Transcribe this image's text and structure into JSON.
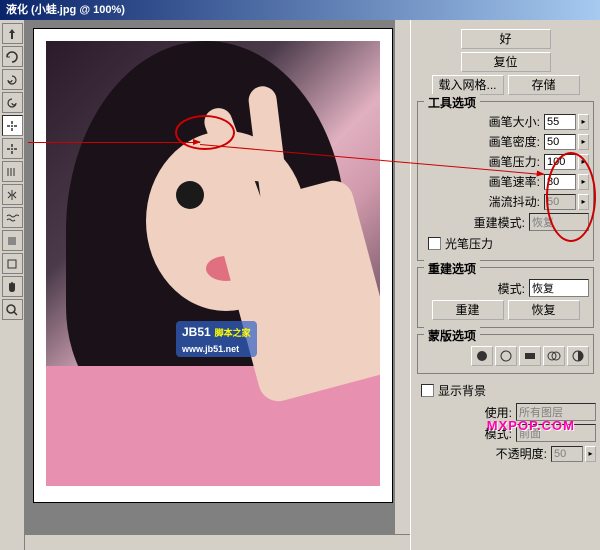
{
  "title": "液化 (小蛙.jpg @ 100%)",
  "tools": [
    {
      "name": "forward-warp-icon"
    },
    {
      "name": "reconstruct-icon"
    },
    {
      "name": "twirl-cw-icon"
    },
    {
      "name": "twirl-ccw-icon"
    },
    {
      "name": "pucker-icon"
    },
    {
      "name": "bloat-icon"
    },
    {
      "name": "push-left-icon"
    },
    {
      "name": "mirror-icon"
    },
    {
      "name": "turbulence-icon"
    },
    {
      "name": "freeze-mask-icon"
    },
    {
      "name": "thaw-mask-icon"
    },
    {
      "name": "hand-icon"
    },
    {
      "name": "zoom-icon"
    }
  ],
  "buttons": {
    "ok": "好",
    "reset": "复位",
    "load_mesh": "载入网格...",
    "save_mesh": "存储",
    "rebuild": "重建",
    "restore": "恢复"
  },
  "sections": {
    "tool_options": "工具选项",
    "rebuild_options": "重建选项",
    "mask_options": "蒙版选项",
    "view_options": ""
  },
  "fields": {
    "brush_size": {
      "label": "画笔大小:",
      "value": "55"
    },
    "brush_density": {
      "label": "画笔密度:",
      "value": "50"
    },
    "brush_pressure": {
      "label": "画笔压力:",
      "value": "100"
    },
    "brush_rate": {
      "label": "画笔速率:",
      "value": "80"
    },
    "turb_jitter": {
      "label": "湍流抖动:",
      "value": "50"
    },
    "reconstruct_mode": {
      "label": "重建模式:",
      "value": "恢复"
    },
    "pen_pressure": "光笔压力",
    "mode": {
      "label": "模式:",
      "value": "恢复"
    },
    "show_bg": "显示背景",
    "use": {
      "label": "使用:",
      "value": "所有图层"
    },
    "mode2": {
      "label": "模式:",
      "value": "前面"
    },
    "opacity": {
      "label": "不透明度:",
      "value": "50"
    }
  },
  "watermark1": {
    "main": "JB51",
    "side": "脚本之家",
    "url": "www.jb51.net"
  },
  "watermark2": "MXPOP.COM"
}
